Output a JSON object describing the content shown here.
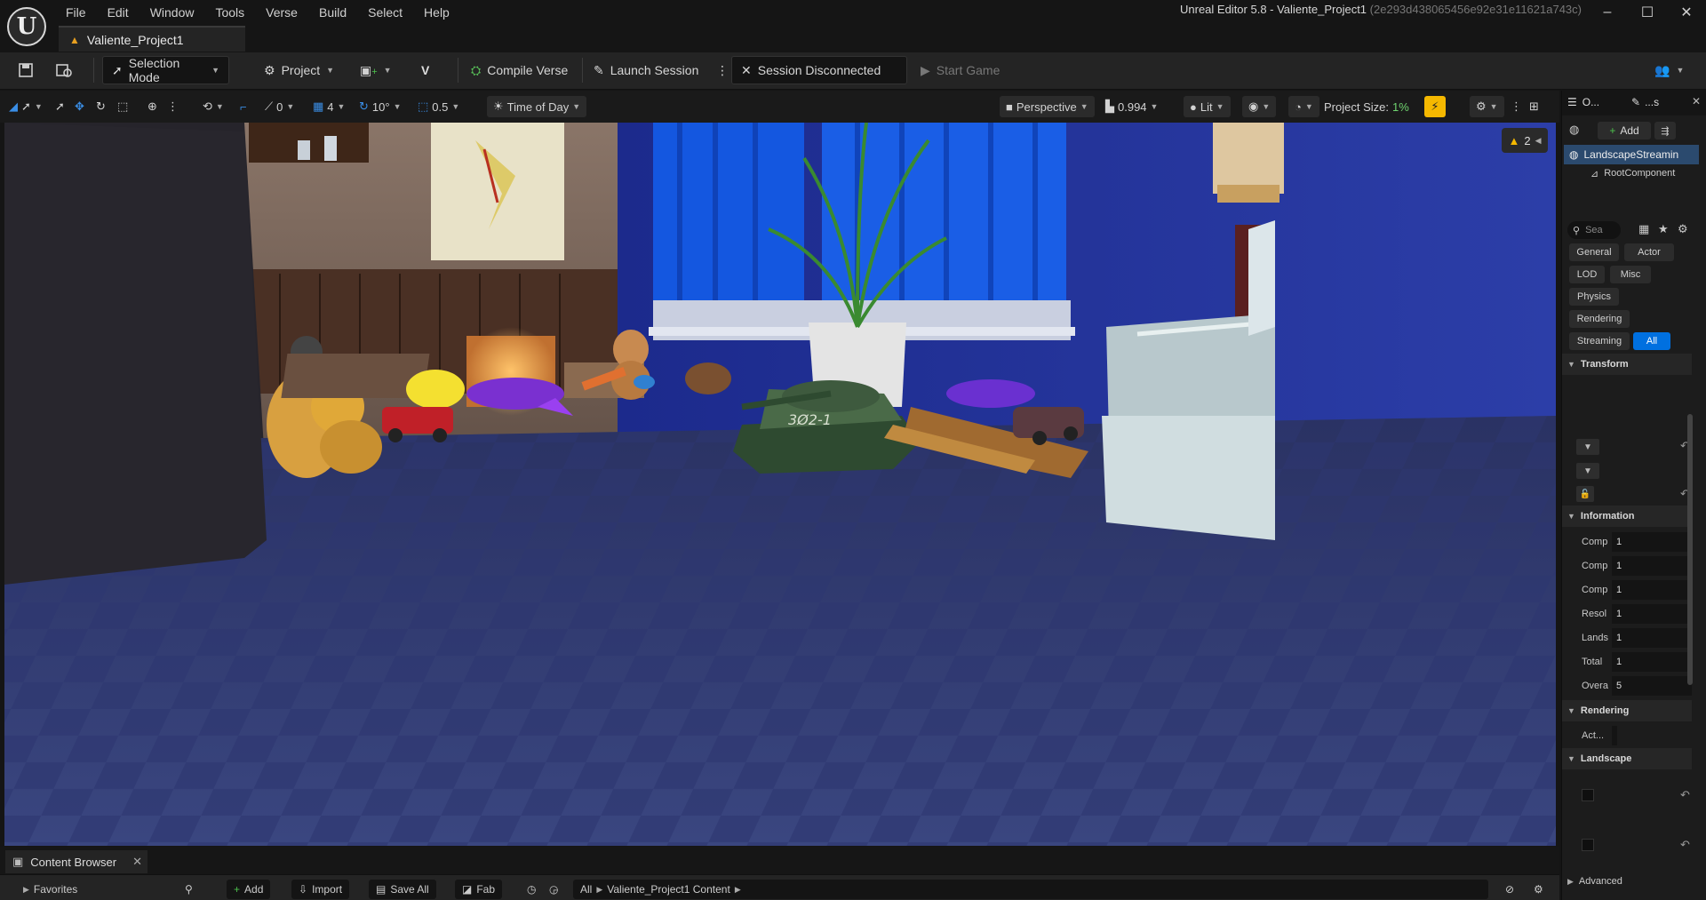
{
  "window": {
    "title": "Unreal Editor 5.8 - Valiente_Project1",
    "hash": "(2e293d438065456e92e31e11621a743c)",
    "project_tab": "Valiente_Project1"
  },
  "menu": [
    "File",
    "Edit",
    "Window",
    "Tools",
    "Verse",
    "Build",
    "Select",
    "Help"
  ],
  "toolbar": {
    "selection_mode": "Selection Mode",
    "project": "Project",
    "compile_verse": "Compile Verse",
    "launch_session": "Launch Session",
    "session_status": "Session Disconnected",
    "start_game": "Start Game"
  },
  "viewport_toolbar": {
    "rotate_snap_value": "0",
    "grid_snap_value": "4",
    "angle_snap_value": "10°",
    "scale_snap_value": "0.5",
    "time_of_day": "Time of Day",
    "perspective": "Perspective",
    "camera_speed": "0.994",
    "view_mode": "Lit",
    "project_size_label": "Project Size:",
    "project_size_value": "1%",
    "warning_count": "2"
  },
  "content_browser": {
    "tab_label": "Content Browser",
    "favorites": "Favorites",
    "add": "Add",
    "import": "Import",
    "save_all": "Save All",
    "fab": "Fab",
    "path_all": "All",
    "path_folder": "Valiente_Project1 Content"
  },
  "details": {
    "outliner_tab": "O...",
    "details_tab": "...s",
    "add_button": "Add",
    "selected_actor": "LandscapeStreamin",
    "root_component": "RootComponent",
    "search_placeholder": "Sea",
    "filters": [
      "General",
      "Actor",
      "LOD",
      "Misc",
      "Physics",
      "Rendering",
      "Streaming",
      "All"
    ],
    "sections": {
      "transform": "Transform",
      "information": "Information",
      "rendering": "Rendering",
      "landscape": "Landscape",
      "advanced": "Advanced"
    },
    "information_rows": [
      {
        "label": "Comp",
        "value": "1"
      },
      {
        "label": "Comp",
        "value": "1"
      },
      {
        "label": "Comp",
        "value": "1"
      },
      {
        "label": "Resol",
        "value": "1"
      },
      {
        "label": "Lands",
        "value": "1"
      },
      {
        "label": "Total",
        "value": "1"
      },
      {
        "label": "Overa",
        "value": "5"
      }
    ],
    "rendering_row": "Act..."
  },
  "viewport_scene": {
    "tank_marking": "3Ø2-1"
  },
  "colors": {
    "accent_blue": "#0070e0",
    "project_size_green": "#6fd36f",
    "warning_yellow": "#f5b800"
  }
}
